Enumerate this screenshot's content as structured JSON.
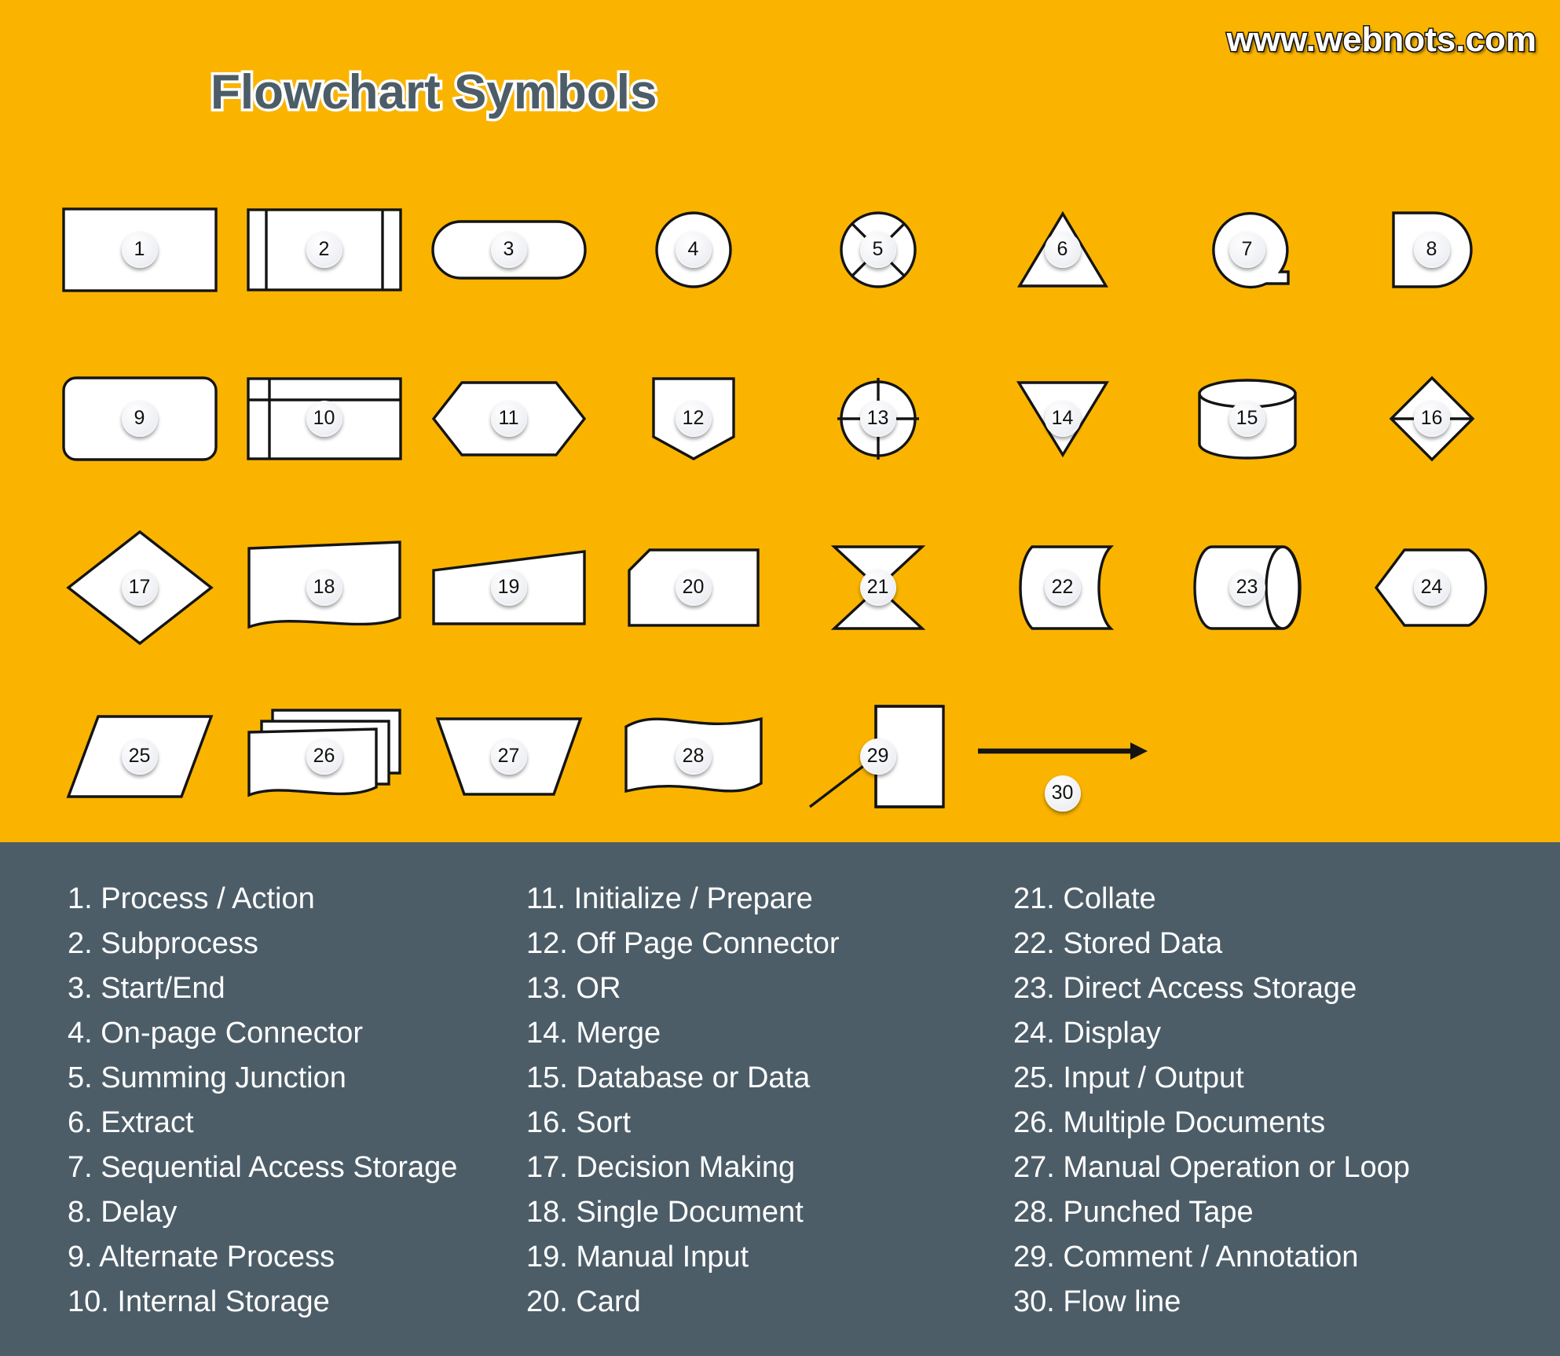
{
  "header": {
    "title": "Flowchart Symbols",
    "watermark": "www.webnots.com"
  },
  "colors": {
    "background_top": "#fab400",
    "background_bottom": "#4c5d68",
    "shape_fill": "#ffffff",
    "shape_stroke": "#141414",
    "legend_text": "#ffffff",
    "title_text": "#4c5d68",
    "title_outline": "#ffffff"
  },
  "symbols": [
    {
      "number": "1",
      "shape": "rectangle",
      "name": "Process / Action"
    },
    {
      "number": "2",
      "shape": "subprocess",
      "name": "Subprocess"
    },
    {
      "number": "3",
      "shape": "stadium",
      "name": "Start/End"
    },
    {
      "number": "4",
      "shape": "circle",
      "name": "On-page Connector"
    },
    {
      "number": "5",
      "shape": "circle-cross-diagonal",
      "name": "Summing Junction"
    },
    {
      "number": "6",
      "shape": "triangle-up",
      "name": "Extract"
    },
    {
      "number": "7",
      "shape": "tape",
      "name": "Sequential Access Storage"
    },
    {
      "number": "8",
      "shape": "delay",
      "name": "Delay"
    },
    {
      "number": "9",
      "shape": "rounded-rectangle",
      "name": "Alternate Process"
    },
    {
      "number": "10",
      "shape": "internal-storage",
      "name": "Internal Storage"
    },
    {
      "number": "11",
      "shape": "hexagon",
      "name": "Initialize / Prepare"
    },
    {
      "number": "12",
      "shape": "off-page-connector",
      "name": "Off Page Connector"
    },
    {
      "number": "13",
      "shape": "circle-plus",
      "name": "OR"
    },
    {
      "number": "14",
      "shape": "triangle-down",
      "name": "Merge"
    },
    {
      "number": "15",
      "shape": "cylinder-vertical",
      "name": "Database or Data"
    },
    {
      "number": "16",
      "shape": "diamond-split",
      "name": "Sort"
    },
    {
      "number": "17",
      "shape": "diamond",
      "name": "Decision Making"
    },
    {
      "number": "18",
      "shape": "document",
      "name": "Single Document"
    },
    {
      "number": "19",
      "shape": "manual-input",
      "name": "Manual Input"
    },
    {
      "number": "20",
      "shape": "card",
      "name": "Card"
    },
    {
      "number": "21",
      "shape": "bowtie",
      "name": "Collate"
    },
    {
      "number": "22",
      "shape": "stored-data",
      "name": "Stored Data"
    },
    {
      "number": "23",
      "shape": "cylinder-horizontal",
      "name": "Direct Access Storage"
    },
    {
      "number": "24",
      "shape": "display",
      "name": "Display"
    },
    {
      "number": "25",
      "shape": "parallelogram",
      "name": "Input / Output"
    },
    {
      "number": "26",
      "shape": "multi-document",
      "name": "Multiple Documents"
    },
    {
      "number": "27",
      "shape": "trapezoid",
      "name": "Manual Operation or Loop"
    },
    {
      "number": "28",
      "shape": "punched-tape",
      "name": "Punched Tape"
    },
    {
      "number": "29",
      "shape": "annotation",
      "name": "Comment / Annotation"
    },
    {
      "number": "30",
      "shape": "arrow",
      "name": "Flow line"
    }
  ],
  "legend": {
    "column1": [
      "1. Process / Action",
      "2. Subprocess",
      "3. Start/End",
      "4. On-page Connector",
      "5. Summing Junction",
      "6. Extract",
      "7. Sequential Access Storage",
      "8. Delay",
      "9. Alternate Process",
      "10. Internal Storage"
    ],
    "column2": [
      "11. Initialize / Prepare",
      "12. Off Page Connector",
      "13. OR",
      "14. Merge",
      "15. Database or Data",
      "16. Sort",
      "17. Decision Making",
      "18. Single Document",
      "19. Manual Input",
      "20. Card"
    ],
    "column3": [
      "21. Collate",
      "22. Stored Data",
      "23. Direct Access Storage",
      "24. Display",
      "25. Input / Output",
      "26. Multiple Documents",
      "27. Manual Operation or Loop",
      "28. Punched Tape",
      "29. Comment / Annotation",
      "30. Flow line"
    ]
  }
}
